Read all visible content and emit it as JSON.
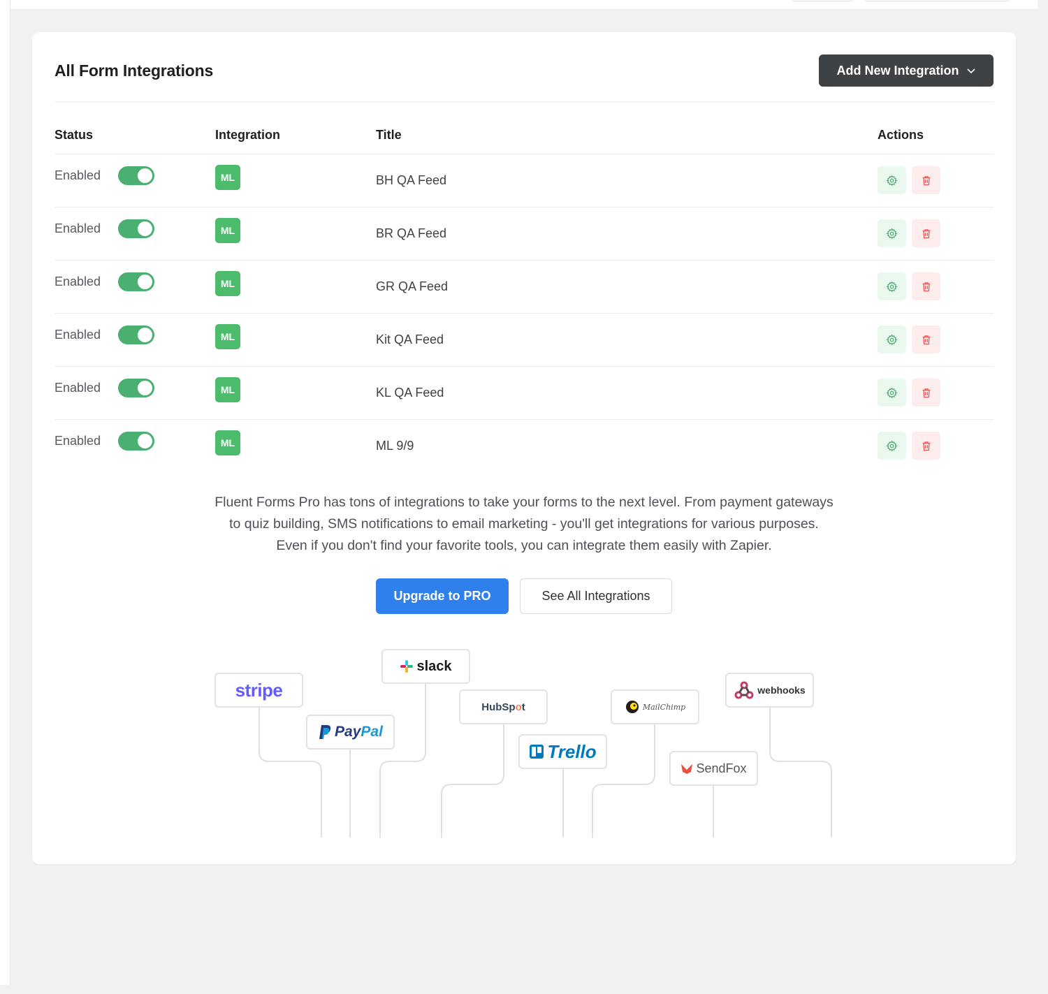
{
  "header": {
    "title": "All Form Integrations",
    "add_button_label": "Add New Integration"
  },
  "table": {
    "columns": [
      "Status",
      "Integration",
      "Title",
      "Actions"
    ],
    "rows": [
      {
        "status": "Enabled",
        "enabled": true,
        "integration": "ML",
        "title": "BH QA Feed"
      },
      {
        "status": "Enabled",
        "enabled": true,
        "integration": "ML",
        "title": "BR QA Feed"
      },
      {
        "status": "Enabled",
        "enabled": true,
        "integration": "ML",
        "title": "GR QA Feed"
      },
      {
        "status": "Enabled",
        "enabled": true,
        "integration": "ML",
        "title": "Kit QA Feed"
      },
      {
        "status": "Enabled",
        "enabled": true,
        "integration": "ML",
        "title": "KL QA Feed"
      },
      {
        "status": "Enabled",
        "enabled": true,
        "integration": "ML",
        "title": "ML 9/9"
      }
    ]
  },
  "promo": {
    "lines": [
      "Fluent Forms Pro has tons of integrations to take your forms to the next level. From payment gateways",
      "to quiz building, SMS notifications to email marketing - you'll get integrations for various purposes.",
      "Even if you don't find your favorite tools, you can integrate them easily with Zapier."
    ],
    "upgrade_label": "Upgrade to PRO",
    "see_all_label": "See All Integrations"
  },
  "logos": {
    "stripe": "stripe",
    "slack": "slack",
    "paypal_a": "Pay",
    "paypal_b": "Pal",
    "hubspot_a": "HubSp",
    "hubspot_b": "o",
    "hubspot_c": "t",
    "trello": "Trello",
    "mailchimp": "MailChimp",
    "sendfox": "SendFox",
    "webhooks": "webhooks"
  },
  "colors": {
    "toggle_on": "#4caf72",
    "badge": "#4cbb6c",
    "primary": "#2f80ed",
    "dark_button": "#3f4245"
  }
}
